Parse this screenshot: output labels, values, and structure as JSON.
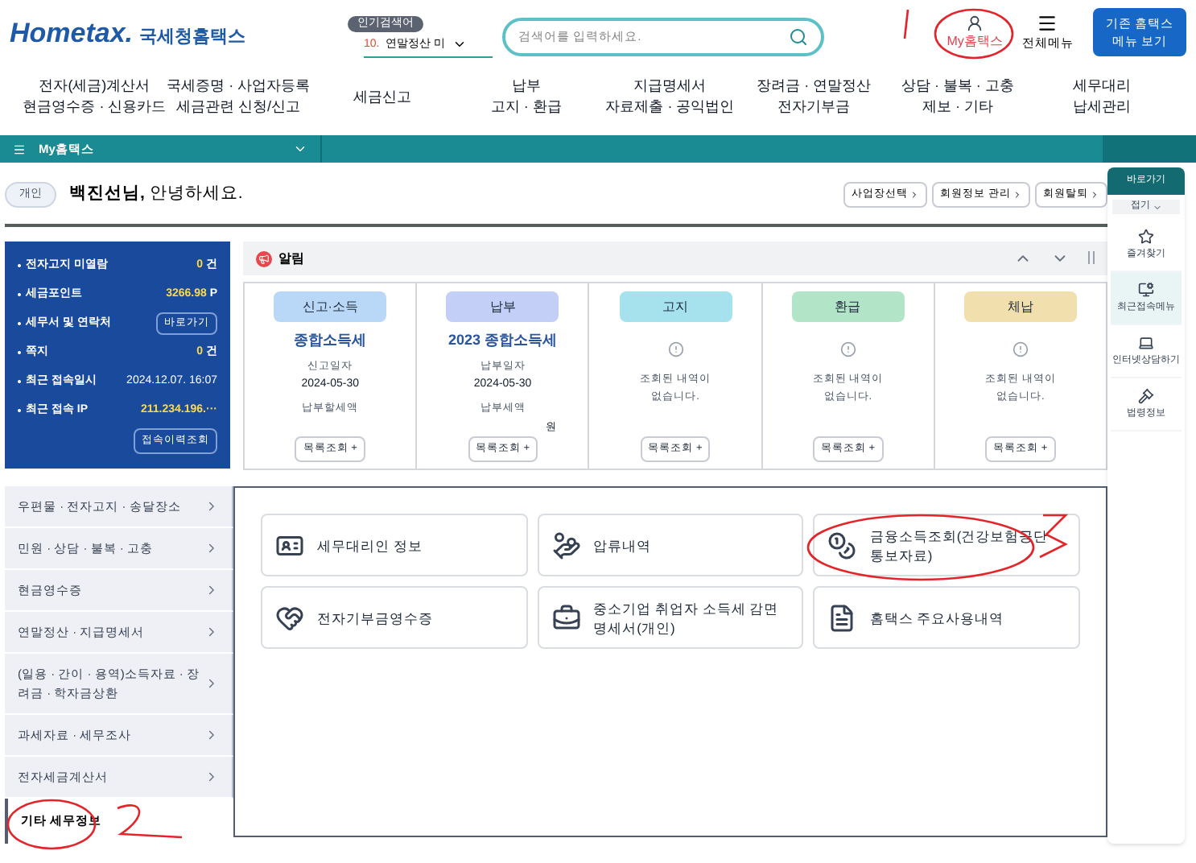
{
  "header": {
    "logo_word": "Hometax.",
    "brand": "국세청홈택스",
    "popular_label": "인기검색어",
    "popular_rank": "10.",
    "popular_item": "연말정산 미",
    "search": {
      "placeholder": "검색어를 입력하세요."
    },
    "my_hometax": "My홈택스",
    "all_menu": "전체메뉴",
    "classic_button": [
      "기존 홈택스",
      "메뉴 보기"
    ]
  },
  "nav": [
    [
      "전자(세금)계산서",
      "현금영수증 · 신용카드"
    ],
    [
      "국세증명 · 사업자등록",
      "세금관련 신청/신고"
    ],
    [
      "세금신고"
    ],
    [
      "납부",
      "고지 · 환급"
    ],
    [
      "지급명세서",
      "자료제출 · 공익법인"
    ],
    [
      "장려금 · 연말정산",
      "전자기부금"
    ],
    [
      "상담 · 불복 · 고충",
      "제보 · 기타"
    ],
    [
      "세무대리",
      "납세관리"
    ]
  ],
  "breadcrumb": "My홈택스",
  "greeting": {
    "badge": "개인",
    "text": "**백진선님,** 안녕하세요.",
    "buttons": [
      "사업장선택",
      "회원정보 관리",
      "회원탈퇴"
    ]
  },
  "summary": {
    "rows": [
      {
        "kind": "value",
        "label": "전자고지 미열람",
        "value": "0",
        "unit": "건"
      },
      {
        "kind": "value",
        "label": "세금포인트",
        "value": "3266.98",
        "unit": "P"
      },
      {
        "kind": "button",
        "label": "세무서 및 연락처",
        "button": "바로가기"
      },
      {
        "kind": "value",
        "label": "쪽지",
        "value": "0",
        "unit": "건"
      },
      {
        "kind": "plain",
        "label": "최근 접속일시",
        "value": "2024.12.07.  16:07"
      },
      {
        "kind": "value",
        "label": "최근 접속 IP",
        "value": "211.234.196.···"
      }
    ],
    "button": "접속이력조회"
  },
  "alerts": {
    "title": "알림",
    "columns": [
      {
        "kind": "entry",
        "tag": "신고·소득",
        "color": "#b9d8f7",
        "title": "종합소득세",
        "date_label": "신고일자",
        "date": "2024-05-30",
        "amount_label": "납부할세액",
        "button": "목록조회 +"
      },
      {
        "kind": "entry",
        "tag": "납부",
        "color": "#c3cff6",
        "title": "2023 종합소득세",
        "date_label": "납부일자",
        "date": "2024-05-30",
        "amount_label": "납부세액",
        "amount": "원",
        "button": "목록조회 +"
      },
      {
        "kind": "empty",
        "tag": "고지",
        "color": "#a5e2ee",
        "message": [
          "조회된 내역이",
          "없습니다."
        ],
        "button": "목록조회 +"
      },
      {
        "kind": "empty",
        "tag": "환급",
        "color": "#b2e5c7",
        "message": [
          "조회된 내역이",
          "없습니다."
        ],
        "button": "목록조회 +"
      },
      {
        "kind": "empty",
        "tag": "체납",
        "color": "#f2dfae",
        "message": [
          "조회된 내역이",
          "없습니다."
        ],
        "button": "목록조회 +"
      }
    ]
  },
  "menu": [
    {
      "label": "우편물 · 전자고지 · 송달장소",
      "selected": false
    },
    {
      "label": "민원 · 상담 · 불복 · 고충",
      "selected": false
    },
    {
      "label": "현금영수증",
      "selected": false
    },
    {
      "label": "연말정산 · 지급명세서",
      "selected": false
    },
    {
      "label": "(일용 · 간이 · 용역)소득자료 · 장려금 · 학자금상환",
      "selected": false
    },
    {
      "label": "과세자료 · 세무조사",
      "selected": false
    },
    {
      "label": "전자세금계산서",
      "selected": false
    },
    {
      "label": "기타 세무정보",
      "selected": true
    }
  ],
  "tiles": [
    {
      "kind": "card",
      "label": "세무대리인 정보"
    },
    {
      "kind": "bag",
      "label": "압류내역"
    },
    {
      "kind": "coins",
      "label": "금융소득조회(건강보험공단 통보자료)"
    },
    {
      "kind": "donation",
      "label": "전자기부금영수증"
    },
    {
      "kind": "briefcase",
      "label": "중소기업 취업자 소득세 감면 명세서(개인)"
    },
    {
      "kind": "document",
      "label": "홈택스 주요사용내역"
    }
  ],
  "quick": {
    "title": "바로가기",
    "fold": "접기",
    "items": [
      {
        "kind": "star",
        "label": "즐겨찾기",
        "selected": false
      },
      {
        "kind": "recent",
        "label": "최근접속메뉴",
        "selected": true
      },
      {
        "kind": "laptop",
        "label": "인터넷상담하기",
        "selected": false
      },
      {
        "kind": "gavel",
        "label": "법령정보",
        "selected": false
      }
    ]
  }
}
